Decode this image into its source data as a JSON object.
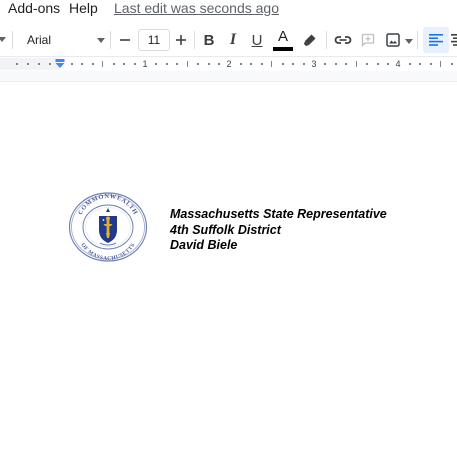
{
  "menu": {
    "addons": "Add-ons",
    "help": "Help",
    "last_edit": "Last edit was seconds ago"
  },
  "toolbar": {
    "font_name": "Arial",
    "font_size": "11",
    "decrease_label": "−",
    "increase_label": "+",
    "bold_label": "B",
    "italic_label": "I",
    "underline_label": "U",
    "text_color_label": "A",
    "text_color": "#000000",
    "active_align_bg": "#e8f0fe",
    "icons": [
      "highlighter-icon",
      "link-icon",
      "add-comment-icon",
      "insert-image-icon",
      "align-left-icon",
      "more-icon"
    ]
  },
  "ruler": {
    "labels": [
      "1",
      "2",
      "3",
      "4"
    ],
    "indent_color": "#4285f4"
  },
  "document": {
    "lines": [
      "Massachusetts State Representative",
      "4th Suffolk District",
      "David Biele"
    ],
    "seal": {
      "outer_text": "COMMONWEALTH",
      "bottom_text": "OF MASSACHUSETTS",
      "ring_color": "#6f7fb0",
      "shield_color": "#233a8c",
      "figure_color": "#e0b030"
    }
  }
}
